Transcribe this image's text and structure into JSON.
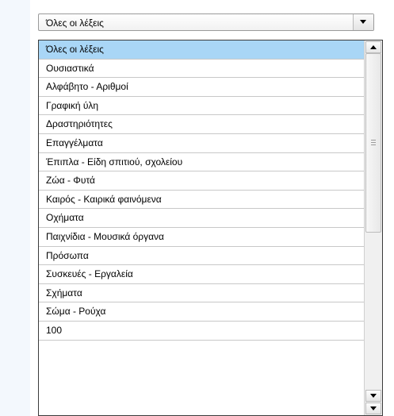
{
  "select": {
    "value": "Όλες οι λέξεις",
    "icon": "chevron-down-icon"
  },
  "dropdown": {
    "selected_index": 0,
    "items": [
      "Όλες οι λέξεις",
      "Ουσιαστικά",
      "Αλφάβητο - Αριθμοί",
      "Γραφική ύλη",
      "Δραστηριότητες",
      "Επαγγέλματα",
      "Έπιπλα - Είδη σπιτιού, σχολείου",
      "Ζώα - Φυτά",
      "Καιρός - Καιρικά φαινόμενα",
      "Οχήματα",
      "Παιχνίδια - Μουσικά όργανα",
      "Πρόσωπα",
      "Συσκευές - Εργαλεία",
      "Σχήματα",
      "Σώμα - Ρούχα",
      "100"
    ]
  },
  "colors": {
    "selected_bg": "#a9d6f6",
    "left_pane_bg": "#f3f8fd"
  }
}
